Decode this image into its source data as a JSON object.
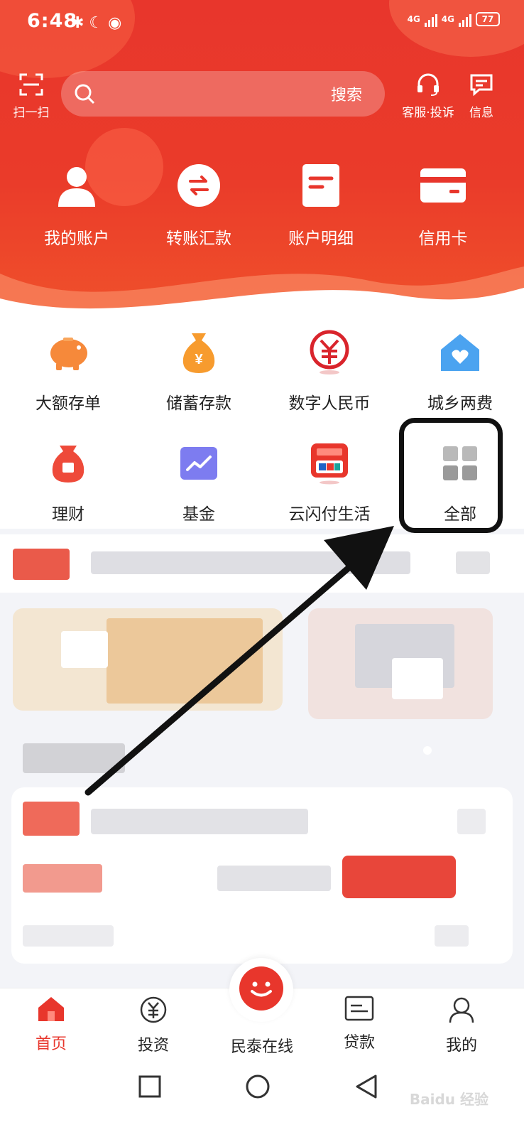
{
  "status_bar": {
    "time": "6:48",
    "network": "4G",
    "battery": "77"
  },
  "top_bar": {
    "scan_label": "扫一扫",
    "search_button": "搜索",
    "service_label": "客服·投诉",
    "messages_label": "信息"
  },
  "quick_actions": [
    {
      "label": "我的账户",
      "icon": "user-icon"
    },
    {
      "label": "转账汇款",
      "icon": "transfer-icon"
    },
    {
      "label": "账户明细",
      "icon": "statement-icon"
    },
    {
      "label": "信用卡",
      "icon": "credit-card-icon"
    }
  ],
  "services": [
    {
      "label": "大额存单",
      "icon": "piggy-bank-icon"
    },
    {
      "label": "储蓄存款",
      "icon": "money-bag-icon"
    },
    {
      "label": "数字人民币",
      "icon": "digital-rmb-icon"
    },
    {
      "label": "城乡两费",
      "icon": "house-heart-icon"
    },
    {
      "label": "理财",
      "icon": "wealth-bag-icon"
    },
    {
      "label": "基金",
      "icon": "fund-chart-icon"
    },
    {
      "label": "云闪付生活",
      "icon": "unionpay-icon"
    },
    {
      "label": "全部",
      "icon": "all-grid-icon"
    }
  ],
  "bottom_nav": [
    {
      "label": "首页",
      "icon": "home-icon",
      "active": true
    },
    {
      "label": "投资",
      "icon": "yuan-circle-icon",
      "active": false
    },
    {
      "label": "民泰在线",
      "icon": "chat-smile-icon",
      "active": false
    },
    {
      "label": "贷款",
      "icon": "loan-card-icon",
      "active": false
    },
    {
      "label": "我的",
      "icon": "profile-icon",
      "active": false
    }
  ],
  "colors": {
    "brand_red": "#e8362c",
    "page_bg": "#f3f4f8"
  }
}
